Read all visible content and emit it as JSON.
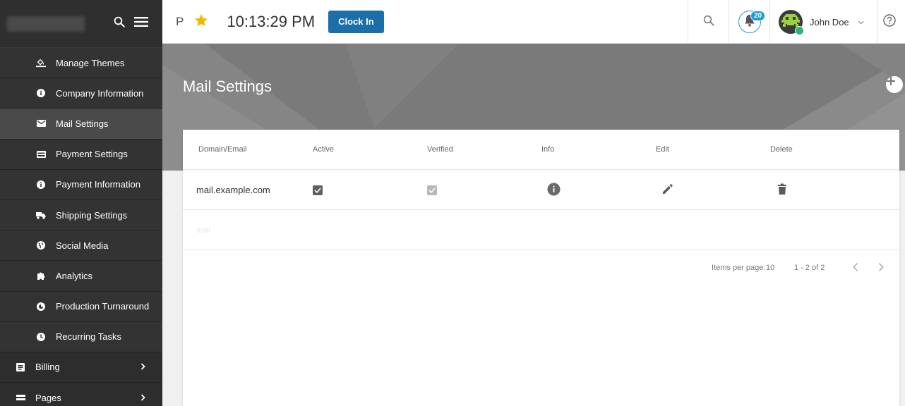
{
  "sidebar": {
    "items": [
      {
        "label": "Manage Themes",
        "icon": "paint-bucket-icon"
      },
      {
        "label": "Company Information",
        "icon": "info-icon"
      },
      {
        "label": "Mail Settings",
        "icon": "mail-icon",
        "active": true
      },
      {
        "label": "Payment Settings",
        "icon": "card-icon"
      },
      {
        "label": "Payment Information",
        "icon": "info-icon"
      },
      {
        "label": "Shipping Settings",
        "icon": "truck-icon"
      },
      {
        "label": "Social Media",
        "icon": "globe-icon"
      },
      {
        "label": "Analytics",
        "icon": "puzzle-icon"
      },
      {
        "label": "Production Turnaround",
        "icon": "gauge-icon"
      },
      {
        "label": "Recurring Tasks",
        "icon": "clock-icon"
      }
    ],
    "sections": [
      {
        "label": "Billing",
        "icon": "billing-icon"
      },
      {
        "label": "Pages",
        "icon": "pages-icon"
      }
    ]
  },
  "topbar": {
    "p_label": "P",
    "time": "10:13:29 PM",
    "clock_in_label": "Clock In",
    "notification_count": "20",
    "user_name": "John Doe"
  },
  "page": {
    "title": "Mail Settings"
  },
  "table": {
    "headers": [
      "Domain/Email",
      "Active",
      "Verified",
      "Info",
      "Edit",
      "Delete"
    ],
    "rows": [
      {
        "domain": "mail.example.com",
        "active": true,
        "verified": true
      }
    ],
    "faded_row_text": "mail"
  },
  "pagination": {
    "items_per_page_label": "Items per page:",
    "items_per_page": "10",
    "range": "1 - 2 of 2"
  },
  "colors": {
    "accent": "#1b6fa8",
    "badge": "#1c9cd8",
    "sidebar_bg": "#333333",
    "banner_bg": "#7a7a7a"
  }
}
